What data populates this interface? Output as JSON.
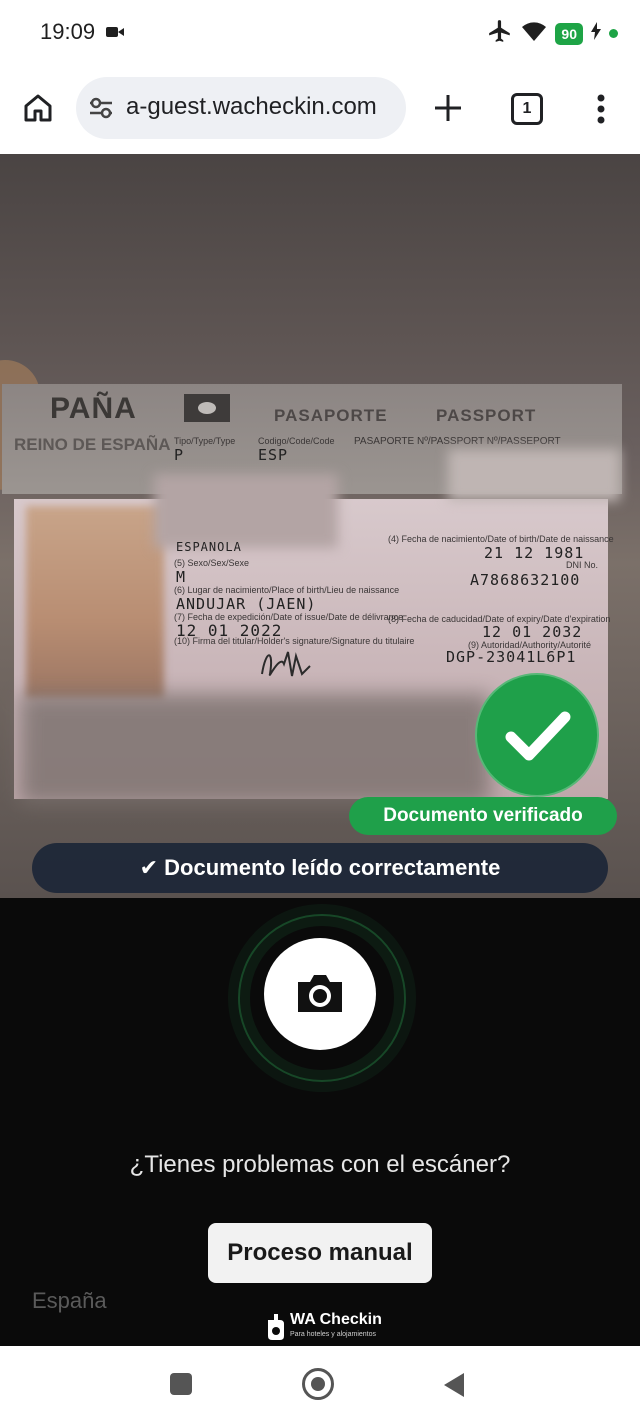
{
  "status_bar": {
    "time": "19:09",
    "battery": "90"
  },
  "browser": {
    "url": "a-guest.wacheckin.com",
    "tab_count": "1"
  },
  "passport": {
    "country_band": "PAÑA",
    "type_label": "PASAPORTE",
    "type_label_en": "PASSPORT",
    "kingdom": "REINO DE ESPAÑA",
    "type_small": "Tipo/Type/Type",
    "code_small": "Codigo/Code/Code",
    "number_small": "PASAPORTE Nº/PASSPORT Nº/PASSEPORT",
    "type_value": "P",
    "code_value": "ESP",
    "sex_small": "(5) Sexo/Sex/Sexe",
    "sex_value": "M",
    "birthplace_small": "(6) Lugar de nacimiento/Place of birth/Lieu de naissance",
    "birthplace_value": "ANDUJAR (JAEN)",
    "issue_small": "(7) Fecha de expedición/Date of issue/Date de délivrance",
    "issue_value": "12 01 2022",
    "sig_small": "(10) Firma del titular/Holder's signature/Signature du titulaire",
    "dob_small": "(4) Fecha de nacimiento/Date of birth/Date de naissance",
    "dob_value": "21 12 1981",
    "id_small": "DNI No.",
    "id_value": "A7868632100",
    "expiry_small": "(8) Fecha de caducidad/Date of expiry/Date d'expiration",
    "expiry_value": "12 01 2032",
    "authority_small": "(9) Autoridad/Authority/Autorité",
    "authority_value": "DGP-23041L6P1",
    "nationality_partial": "ESPANOLA"
  },
  "verified_label": "Documento verificado",
  "read_message": "✔ Documento leído correctamente",
  "scanner_question": "¿Tienes problemas con el escáner?",
  "manual_button": "Proceso manual",
  "country": "España",
  "brand": {
    "name": "WA Checkin",
    "tagline": "Para hoteles y alojamientos"
  },
  "colors": {
    "success": "#1fa04a",
    "pill": "#1c2637",
    "background": "#0a0a0a"
  },
  "icons": [
    "video-camera-icon",
    "airplane-icon",
    "wifi-icon",
    "charging-icon",
    "home-icon",
    "site-settings-icon",
    "plus-icon",
    "kebab-menu-icon",
    "check-icon",
    "camera-icon",
    "wa-checkin-logo-icon",
    "nav-recents-icon",
    "nav-home-icon",
    "nav-back-icon"
  ]
}
